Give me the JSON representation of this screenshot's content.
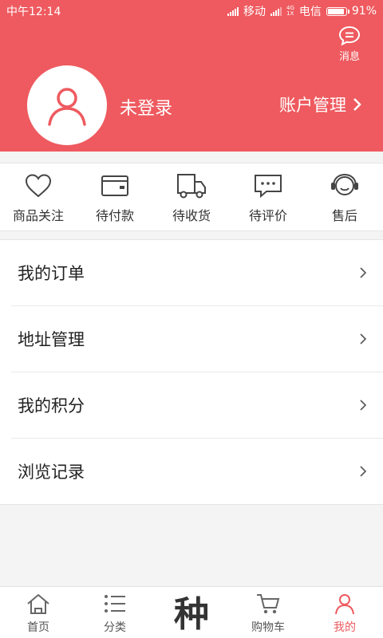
{
  "status_bar": {
    "time": "中午12:14",
    "carrier1": "移动",
    "tech_top": "4G",
    "tech_bottom": "1X",
    "carrier2": "电信",
    "battery": "91%",
    "battery_level": 0.91
  },
  "header": {
    "message_label": "消息",
    "login_status": "未登录",
    "account_label": "账户管理"
  },
  "orders": [
    {
      "label": "商品关注",
      "icon": "heart-icon"
    },
    {
      "label": "待付款",
      "icon": "wallet-icon"
    },
    {
      "label": "待收货",
      "icon": "truck-icon"
    },
    {
      "label": "待评价",
      "icon": "comment-icon"
    },
    {
      "label": "售后",
      "icon": "headset-icon"
    }
  ],
  "menu": [
    {
      "label": "我的订单"
    },
    {
      "label": "地址管理"
    },
    {
      "label": "我的积分"
    },
    {
      "label": "浏览记录"
    }
  ],
  "tabs": [
    {
      "label": "首页",
      "icon": "home-icon"
    },
    {
      "label": "分类",
      "icon": "list-icon"
    },
    {
      "label": "种",
      "icon": "brand-glyph"
    },
    {
      "label": "购物车",
      "icon": "cart-icon"
    },
    {
      "label": "我的",
      "icon": "user-icon"
    }
  ],
  "colors": {
    "accent": "#ee5a5f"
  }
}
